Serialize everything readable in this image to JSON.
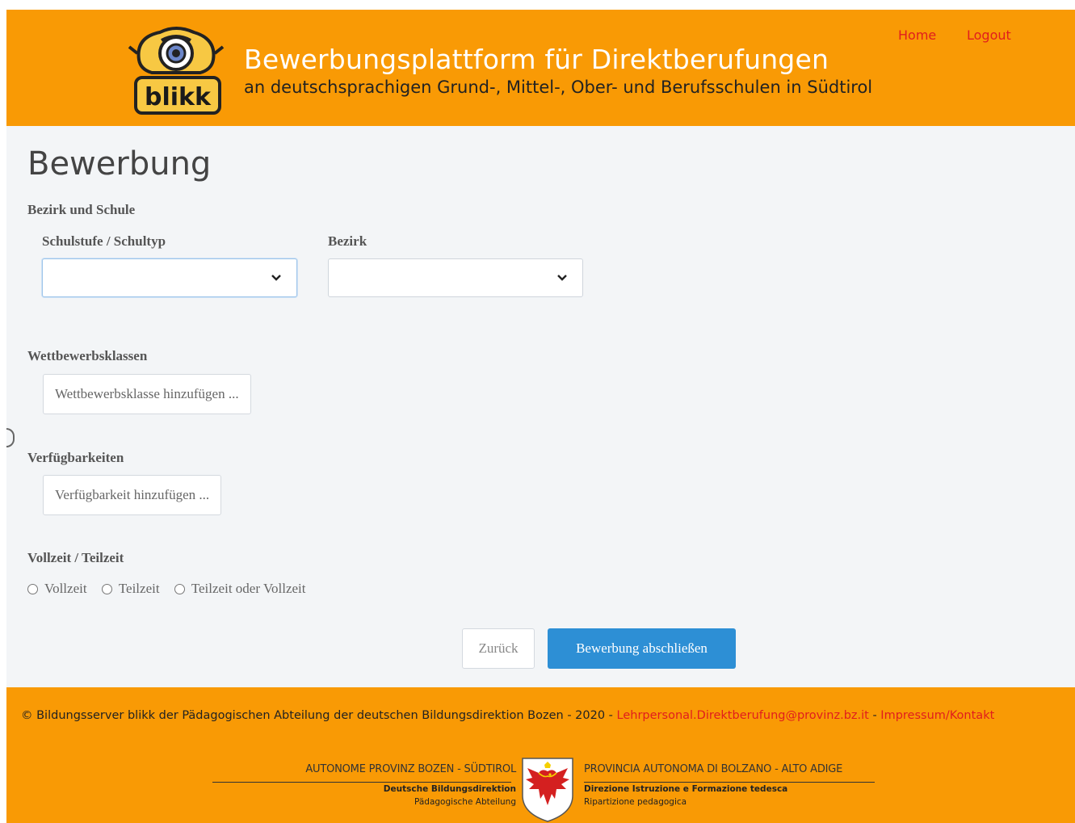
{
  "header": {
    "title": "Bewerbungsplattform für Direktberufungen",
    "subtitle": "an deutschsprachigen Grund-, Mittel-, Ober- und Berufsschulen in Südtirol",
    "logo_text": "blikk",
    "nav": {
      "home": "Home",
      "logout": "Logout"
    },
    "color": "#f99a05"
  },
  "page_title": "Bewerbung",
  "sections": {
    "school": {
      "heading": "Bezirk und Schule",
      "schooltype_label": "Schulstufe / Schultyp",
      "schooltype_value": "",
      "district_label": "Bezirk",
      "district_value": ""
    },
    "competition": {
      "heading": "Wettbewerbsklassen",
      "add_button": "Wettbewerbsklasse hinzufügen ..."
    },
    "availability": {
      "heading": "Verfügbarkeiten",
      "add_button": "Verfügbarkeit hinzufügen ..."
    },
    "worktime": {
      "heading": "Vollzeit / Teilzeit",
      "options": [
        "Vollzeit",
        "Teilzeit",
        "Teilzeit oder Vollzeit"
      ]
    }
  },
  "actions": {
    "back": "Zurück",
    "submit": "Bewerbung abschließen",
    "submit_color": "#2d8fd5"
  },
  "footer": {
    "copyright": "© Bildungsserver blikk der Pädagogischen Abteilung der deutschen Bildungsdirektion Bozen - 2020 - ",
    "email": "Lehrpersonal.Direktberufung@provinz.bz.it",
    "separator": " - ",
    "impressum": "Impressum/Kontakt",
    "province": {
      "left_title": "AUTONOME PROVINZ BOZEN - SÜDTIROL",
      "left_line1": "Deutsche Bildungsdirektion",
      "left_line2": "Pädagogische Abteilung",
      "right_title": "PROVINCIA AUTONOMA DI BOLZANO - ALTO ADIGE",
      "right_line1": "Direzione Istruzione e Formazione tedesca",
      "right_line2": "Ripartizione pedagogica"
    }
  }
}
